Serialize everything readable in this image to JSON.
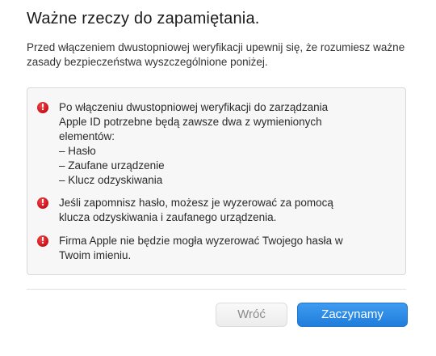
{
  "dialog": {
    "title": "Ważne rzeczy do zapamiętania.",
    "intro": "Przed włączeniem dwustopniowej weryfikacji upewnij się, że rozumiesz ważne zasady bezpieczeństwa wyszczególnione poniżej.",
    "notes": [
      {
        "icon": "exclamation-alert-icon",
        "lines": [
          "Po włączeniu dwustopniowej weryfikacji do zarządzania",
          "Apple ID potrzebne będą zawsze dwa z wymienionych",
          "elementów:",
          "– Hasło",
          "– Zaufane urządzenie",
          "– Klucz odzyskiwania"
        ]
      },
      {
        "icon": "exclamation-alert-icon",
        "lines": [
          "Jeśli zapomnisz hasło, możesz je wyzerować za pomocą",
          "klucza odzyskiwania i zaufanego urządzenia."
        ]
      },
      {
        "icon": "exclamation-alert-icon",
        "lines": [
          "Firma Apple nie będzie mogła wyzerować Twojego hasła w",
          "Twoim imieniu."
        ]
      }
    ],
    "alert_glyph": "!",
    "buttons": {
      "back_label": "Wróć",
      "start_label": "Zaczynamy"
    },
    "colors": {
      "alert": "#d0021b",
      "primary_button": "#2a8ae6",
      "panel_background": "#f7f7f7"
    }
  }
}
